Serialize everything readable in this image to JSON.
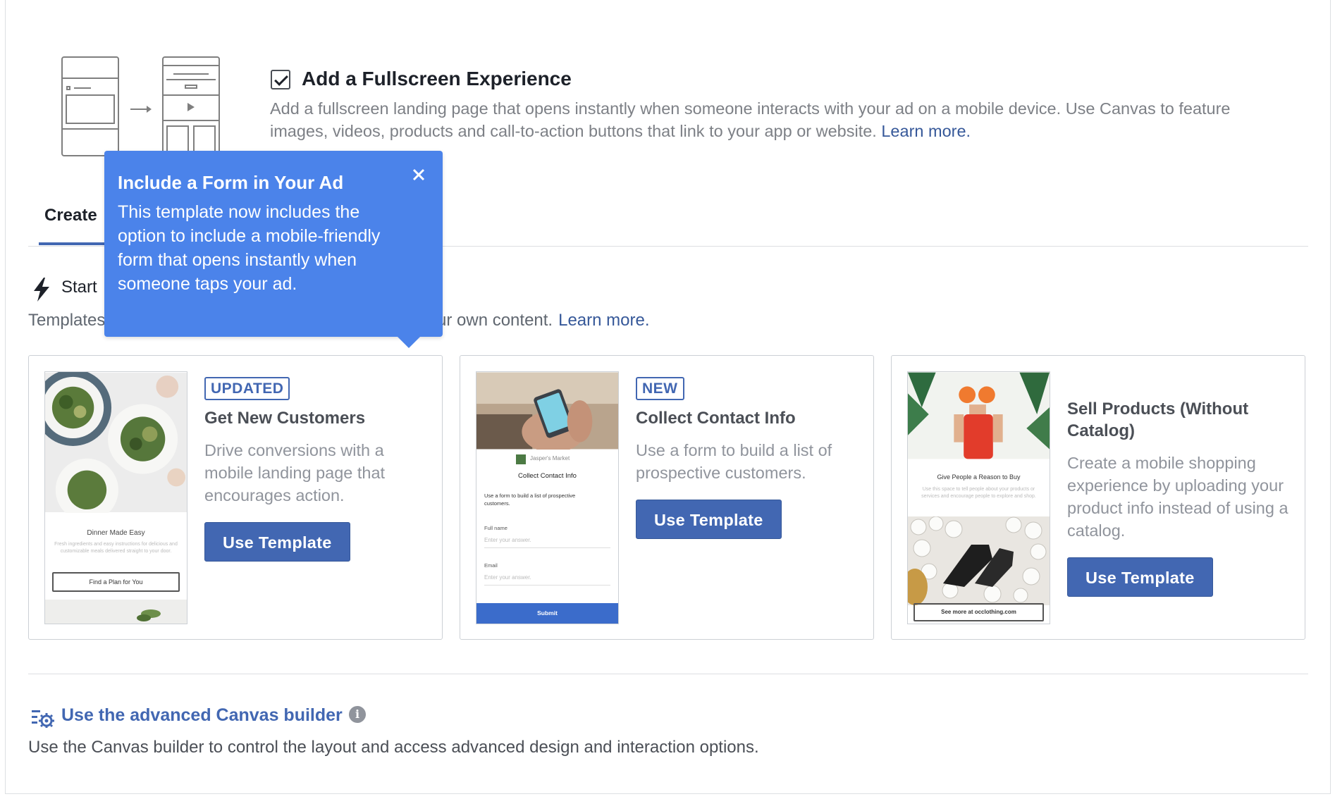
{
  "fullscreen": {
    "checked": true,
    "title": "Add a Fullscreen Experience",
    "description": "Add a fullscreen landing page that opens instantly when someone interacts with your ad on a mobile device. Use Canvas to feature images, videos, products and call-to-action buttons that link to your app or website.",
    "learn_more": "Learn more."
  },
  "tabs": {
    "create_label": "Create"
  },
  "start": {
    "label": "Start",
    "templates_prefix": "Templates",
    "templates_suffix": "ur own content.",
    "learn_more": "Learn more."
  },
  "tooltip": {
    "title": "Include a Form in Your Ad",
    "body": "This template now includes the option to include a mobile-friendly form that opens instantly when someone taps your ad."
  },
  "cards": [
    {
      "badge": "UPDATED",
      "title": "Get New Customers",
      "description": "Drive conversions with a mobile landing page that encourages action.",
      "button": "Use Template",
      "thumb": {
        "caption": "Dinner Made Easy",
        "small": "Fresh ingredients and easy instructions for delicious and customizable meals delivered straight to your door.",
        "cta": "Find a Plan for You"
      }
    },
    {
      "badge": "NEW",
      "title": "Collect Contact Info",
      "description": "Use a form to build a list of prospective customers.",
      "button": "Use Template",
      "thumb": {
        "brand": "Jasper's Market",
        "caption": "Collect Contact Info",
        "small": "Use a form to build a list of prospective customers.",
        "field1_label": "Full name",
        "field1_placeholder": "Enter your answer.",
        "field2_label": "Email",
        "field2_placeholder": "Enter your answer.",
        "submit": "Submit"
      }
    },
    {
      "badge": "",
      "title": "Sell Products (Without Catalog)",
      "description": "Create a mobile shopping experience by uploading your product info instead of using a catalog.",
      "button": "Use Template",
      "thumb": {
        "caption": "Give People a Reason to Buy",
        "small": "Use this space to tell people about your products or services and encourage people to explore and shop.",
        "cta": "See more at occlothing.com"
      }
    }
  ],
  "advanced": {
    "title": "Use the advanced Canvas builder",
    "description": "Use the Canvas builder to control the layout and access advanced design and interaction options."
  },
  "colors": {
    "accent": "#4267b2",
    "tooltip": "#4b83ea",
    "muted_text": "#90949c"
  }
}
